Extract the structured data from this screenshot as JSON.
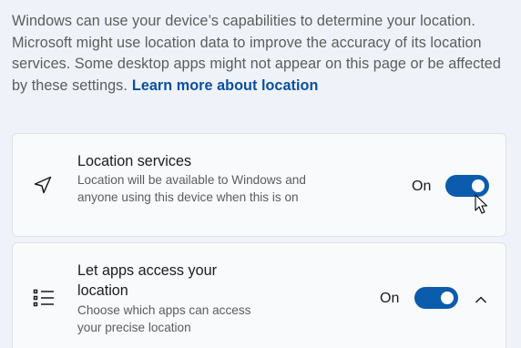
{
  "intro": {
    "text": "Windows can use your device’s capabilities to determine your location. Microsoft might use location data to improve the accuracy of its location services. Some desktop apps might not appear on this page or be affected by these settings.",
    "link_label": "Learn more about location"
  },
  "location_services": {
    "title": "Location services",
    "description": "Location will be available to Windows and anyone using this device when this is on",
    "state_label": "On",
    "toggle_on": true,
    "icon": "location-arrow-icon"
  },
  "apps_access": {
    "title": "Let apps access your location",
    "description": "Choose which apps can access your precise location",
    "state_label": "On",
    "toggle_on": true,
    "icon": "bulleted-list-icon",
    "expanded": true
  },
  "colors": {
    "accent": "#0b5cad",
    "link": "#0a4fa0",
    "background": "#eff3f9",
    "card": "#f9fafc"
  }
}
